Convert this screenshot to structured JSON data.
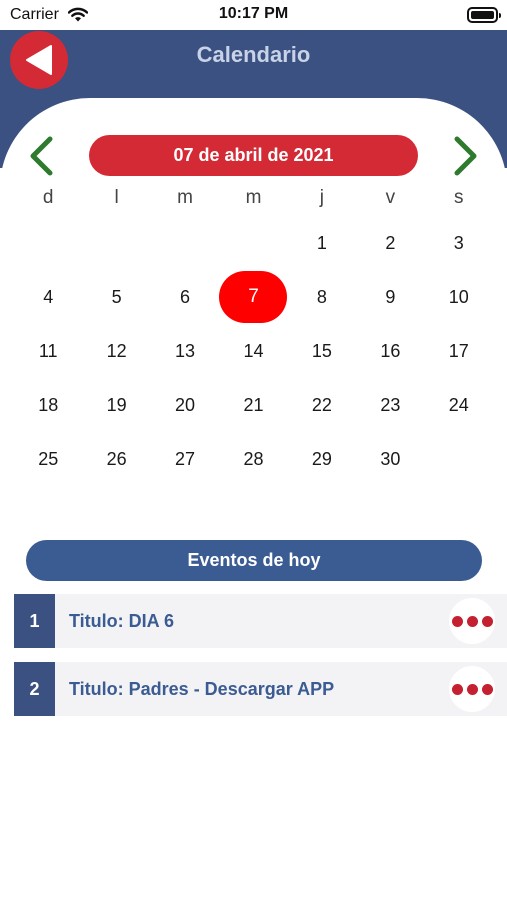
{
  "status_bar": {
    "carrier": "Carrier",
    "time": "10:17 PM"
  },
  "header": {
    "title": "Calendario"
  },
  "calendar": {
    "current_date": "07 de abril de 2021",
    "weekdays": [
      "d",
      "l",
      "m",
      "m",
      "j",
      "v",
      "s"
    ],
    "leading_blanks": 4,
    "days": [
      "1",
      "2",
      "3",
      "4",
      "5",
      "6",
      "7",
      "8",
      "9",
      "10",
      "11",
      "12",
      "13",
      "14",
      "15",
      "16",
      "17",
      "18",
      "19",
      "20",
      "21",
      "22",
      "23",
      "24",
      "25",
      "26",
      "27",
      "28",
      "29",
      "30"
    ],
    "selected_day": "7"
  },
  "events": {
    "header": "Eventos de hoy",
    "items": [
      {
        "index": "1",
        "title": "Titulo: DIA 6"
      },
      {
        "index": "2",
        "title": "Titulo: Padres - Descargar APP"
      }
    ]
  },
  "colors": {
    "header_blue": "#3b5181",
    "accent_red": "#d42a35",
    "selected_red": "#ff0000",
    "nav_green": "#2e7a2e",
    "event_blue": "#3b5b93"
  }
}
